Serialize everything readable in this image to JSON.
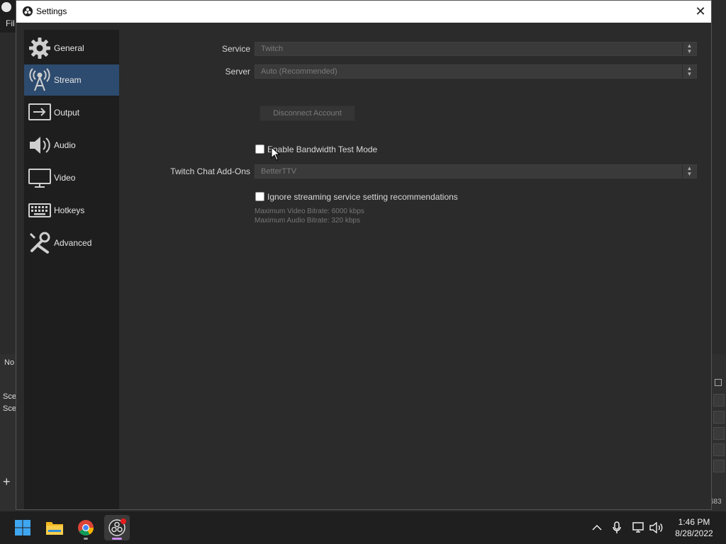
{
  "background_app": {
    "menu_file": "Fil",
    "label_no": "No",
    "scene1": "Sce",
    "scene2": "Sce",
    "add": "+",
    "number": "683"
  },
  "dialog": {
    "title": "Settings",
    "close": "✕"
  },
  "sidebar": {
    "items": [
      {
        "label": "General",
        "icon": "gear-icon"
      },
      {
        "label": "Stream",
        "icon": "broadcast-tower-icon",
        "active": true
      },
      {
        "label": "Output",
        "icon": "output-icon"
      },
      {
        "label": "Audio",
        "icon": "speaker-icon"
      },
      {
        "label": "Video",
        "icon": "monitor-icon"
      },
      {
        "label": "Hotkeys",
        "icon": "keyboard-icon"
      },
      {
        "label": "Advanced",
        "icon": "tools-icon"
      }
    ]
  },
  "stream": {
    "service_label": "Service",
    "service_value": "Twitch",
    "server_label": "Server",
    "server_value": "Auto (Recommended)",
    "disconnect_button": "Disconnect Account",
    "bandwidth_test_label": "Enable Bandwidth Test Mode",
    "bandwidth_test_checked": false,
    "chat_addons_label": "Twitch Chat Add-Ons",
    "chat_addons_value": "BetterTTV",
    "ignore_recommendations_label": "Ignore streaming service setting recommendations",
    "ignore_recommendations_checked": false,
    "max_video_bitrate": "Maximum Video Bitrate: 6000 kbps",
    "max_audio_bitrate": "Maximum Audio Bitrate: 320 kbps"
  },
  "taskbar": {
    "apps": [
      "start-icon",
      "file-explorer-icon",
      "chrome-icon",
      "obs-icon"
    ],
    "tray": [
      "chevron-up-icon",
      "microphone-icon",
      "network-icon",
      "volume-icon"
    ],
    "time": "1:46 PM",
    "date": "8/28/2022"
  },
  "colors": {
    "dialog_bg": "#2b2b2b",
    "sidebar_bg": "#1e1e1e",
    "active_item": "#2d4b6e",
    "taskbar_bg": "#1f1f1f"
  }
}
